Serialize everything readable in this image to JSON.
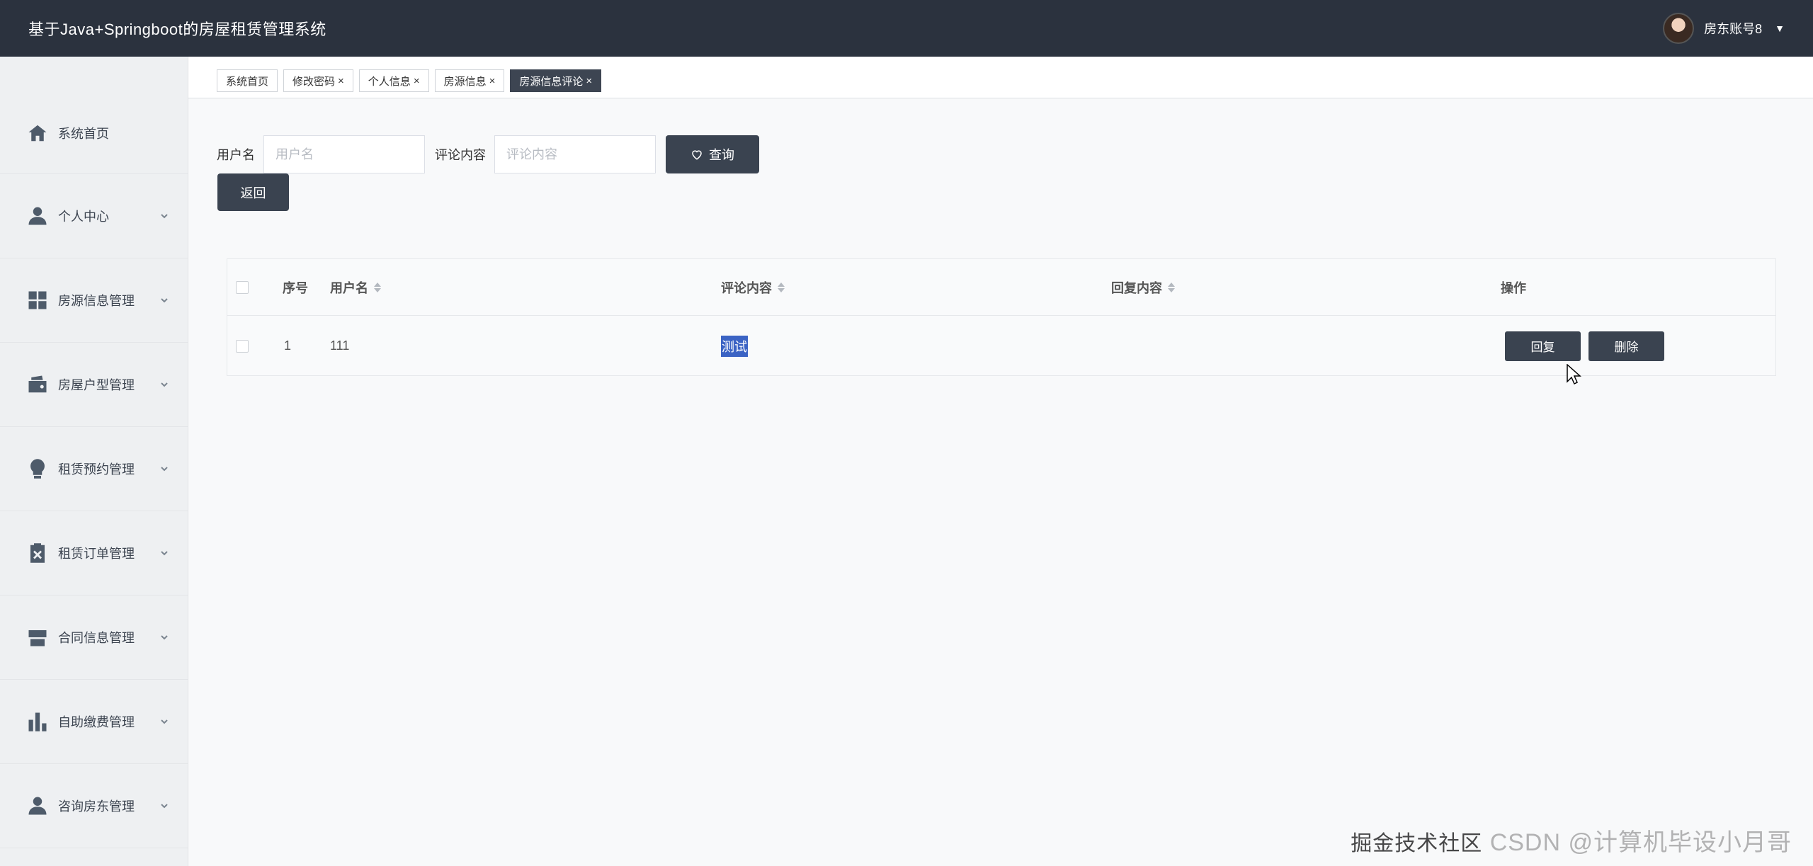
{
  "header": {
    "app_title": "基于Java+Springboot的房屋租赁管理系统",
    "username": "房东账号8"
  },
  "tabs": [
    {
      "label": "系统首页",
      "closable": false,
      "active": false
    },
    {
      "label": "修改密码",
      "closable": true,
      "active": false
    },
    {
      "label": "个人信息",
      "closable": true,
      "active": false
    },
    {
      "label": "房源信息",
      "closable": true,
      "active": false
    },
    {
      "label": "房源信息评论",
      "closable": true,
      "active": true
    }
  ],
  "tab_close_glyph": "×",
  "sidebar": {
    "items": [
      {
        "label": "系统首页",
        "icon": "home-icon"
      },
      {
        "label": "个人中心",
        "icon": "user-icon"
      },
      {
        "label": "房源信息管理",
        "icon": "grid-icon"
      },
      {
        "label": "房屋户型管理",
        "icon": "wallet-icon"
      },
      {
        "label": "租赁预约管理",
        "icon": "bulb-icon"
      },
      {
        "label": "租赁订单管理",
        "icon": "clipboard-x-icon"
      },
      {
        "label": "合同信息管理",
        "icon": "store-icon"
      },
      {
        "label": "自助缴费管理",
        "icon": "bar-chart-icon"
      },
      {
        "label": "咨询房东管理",
        "icon": "user-icon"
      }
    ]
  },
  "search": {
    "username_label": "用户名",
    "username_placeholder": "用户名",
    "comment_label": "评论内容",
    "comment_placeholder": "评论内容",
    "search_button": "查询",
    "back_button": "返回"
  },
  "table": {
    "headers": {
      "index": "序号",
      "username": "用户名",
      "comment": "评论内容",
      "reply": "回复内容",
      "actions": "操作"
    },
    "rows": [
      {
        "index": "1",
        "username": "111",
        "comment": "测试",
        "reply": "",
        "reply_button": "回复",
        "delete_button": "删除"
      }
    ]
  },
  "watermark": {
    "text": "CSDN @计算机毕设小月哥",
    "sub": "掘金技术社区"
  },
  "colors": {
    "topbar": "#2b323e",
    "button_dark": "#3a4350",
    "selection_highlight": "#3b63c4"
  }
}
